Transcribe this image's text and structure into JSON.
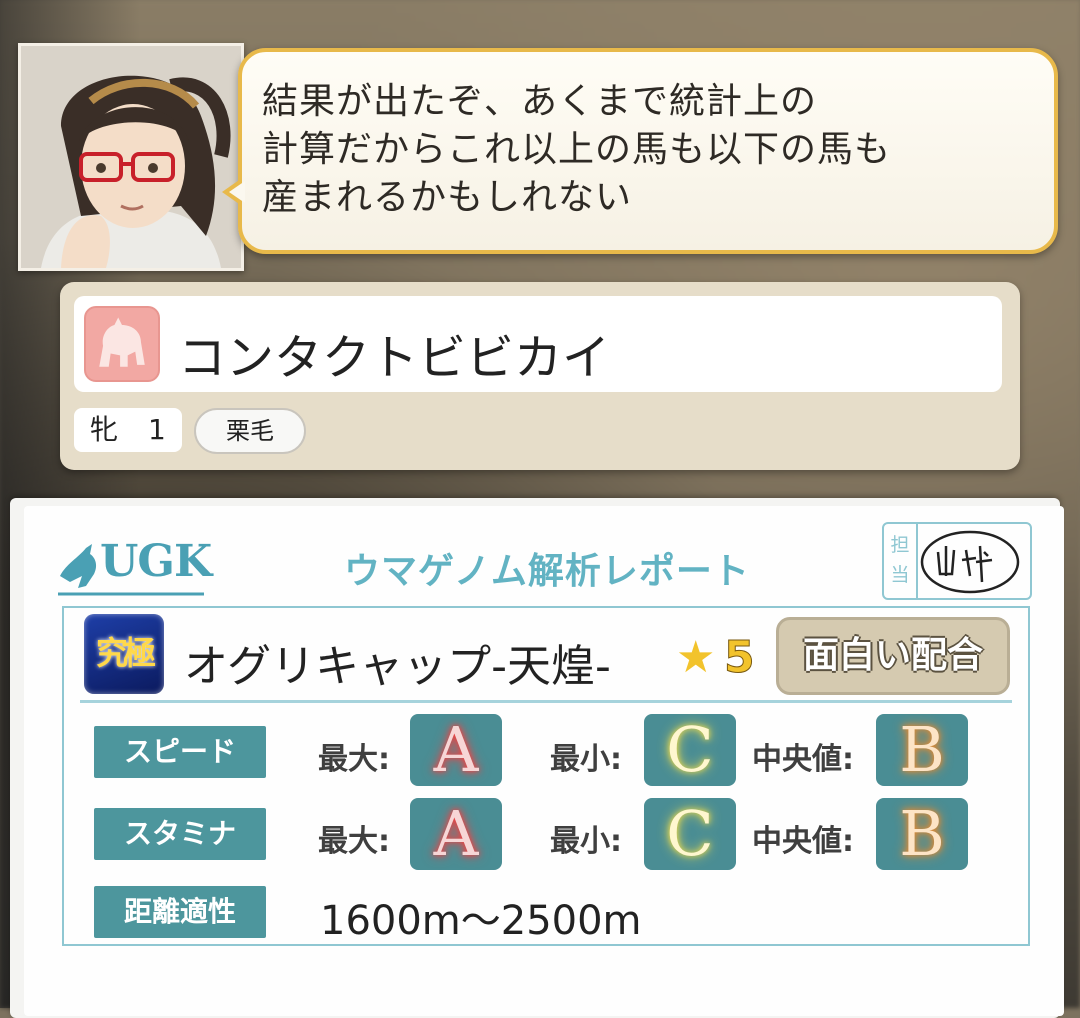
{
  "dialogue": {
    "speaker_portrait": "scientist-woman-portrait",
    "lines": [
      "結果が出たぞ、あくまで統計上の",
      "計算だからこれ以上の馬も以下の馬も",
      "産まれるかもしれない"
    ]
  },
  "horse": {
    "icon": "horse-icon",
    "name": "コンタクトビビカイ",
    "sex": "牝",
    "age": "1",
    "coat": "栗毛"
  },
  "report": {
    "logo_text": "UGK",
    "title": "ウマゲノム解析レポート",
    "stamp_label": "担当",
    "stamp_signature": "山科",
    "sire_badge": "究極",
    "sire_name": "オグリキャップ-天煌-",
    "rarity_star": "★",
    "rarity": "5",
    "rating_button": "面白い配合",
    "rows": [
      {
        "label": "スピード",
        "max_label": "最大:",
        "max": "A",
        "min_label": "最小:",
        "min": "C",
        "median_label": "中央値:",
        "median": "B"
      },
      {
        "label": "スタミナ",
        "max_label": "最大:",
        "max": "A",
        "min_label": "最小:",
        "min": "C",
        "median_label": "中央値:",
        "median": "B"
      }
    ],
    "distance_label": "距離適性",
    "distance": "1600m〜2500m"
  },
  "colors": {
    "bubble_border": "#e8b94a",
    "teal_label": "#4d969d",
    "title_teal": "#62b3c3",
    "grade_A_glow": "#ff3b3b",
    "grade_B_glow": "#f08a2a",
    "grade_C_glow": "#f5df4a"
  }
}
